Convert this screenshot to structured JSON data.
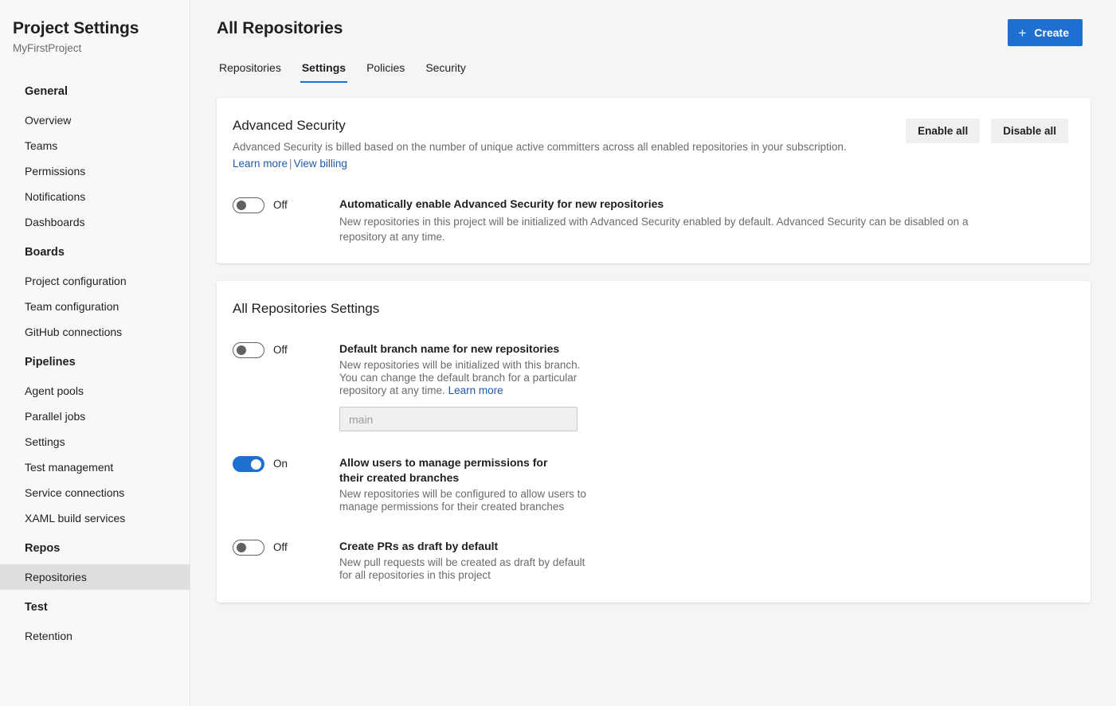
{
  "sidebar": {
    "title": "Project Settings",
    "subtitle": "MyFirstProject",
    "groups": [
      {
        "header": "General",
        "items": [
          {
            "label": "Overview",
            "selected": false
          },
          {
            "label": "Teams",
            "selected": false
          },
          {
            "label": "Permissions",
            "selected": false
          },
          {
            "label": "Notifications",
            "selected": false
          },
          {
            "label": "Dashboards",
            "selected": false
          }
        ]
      },
      {
        "header": "Boards",
        "items": [
          {
            "label": "Project configuration",
            "selected": false
          },
          {
            "label": "Team configuration",
            "selected": false
          },
          {
            "label": "GitHub connections",
            "selected": false
          }
        ]
      },
      {
        "header": "Pipelines",
        "items": [
          {
            "label": "Agent pools",
            "selected": false
          },
          {
            "label": "Parallel jobs",
            "selected": false
          },
          {
            "label": "Settings",
            "selected": false
          },
          {
            "label": "Test management",
            "selected": false
          },
          {
            "label": "Service connections",
            "selected": false
          },
          {
            "label": "XAML build services",
            "selected": false
          }
        ]
      },
      {
        "header": "Repos",
        "items": [
          {
            "label": "Repositories",
            "selected": true
          }
        ]
      },
      {
        "header": "Test",
        "items": [
          {
            "label": "Retention",
            "selected": false
          }
        ]
      }
    ]
  },
  "header": {
    "page_title": "All Repositories",
    "create_button": {
      "label": "Create",
      "icon": "plus-icon"
    },
    "tabs": [
      {
        "label": "Repositories",
        "active": false
      },
      {
        "label": "Settings",
        "active": true
      },
      {
        "label": "Policies",
        "active": false
      },
      {
        "label": "Security",
        "active": false
      }
    ]
  },
  "advanced_security": {
    "heading": "Advanced Security",
    "description": "Advanced Security is billed based on the number of unique active committers across all enabled repositories in your subscription.",
    "links": {
      "learn_more": "Learn more",
      "separator": "|",
      "view_billing": "View billing"
    },
    "actions": {
      "enable_all": "Enable all",
      "disable_all": "Disable all"
    },
    "setting": {
      "state": "Off",
      "on": false,
      "title": "Automatically enable Advanced Security for new repositories",
      "description": "New repositories in this project will be initialized with Advanced Security enabled by default. Advanced Security can be disabled on a repository at any time."
    }
  },
  "all_repositories_settings": {
    "heading": "All Repositories Settings",
    "settings": [
      {
        "state": "Off",
        "on": false,
        "title": "Default branch name for new repositories",
        "description": "New repositories will be initialized with this branch. You can change the default branch for a particular repository at any time.",
        "inline_link": "Learn more",
        "input_placeholder": "main",
        "input_value": ""
      },
      {
        "state": "On",
        "on": true,
        "title": "Allow users to manage permissions for their created branches",
        "description": "New repositories will be configured to allow users to manage permissions for their created branches"
      },
      {
        "state": "Off",
        "on": false,
        "title": "Create PRs as draft by default",
        "description": "New pull requests will be created as draft by default for all repositories in this project"
      }
    ]
  },
  "colors": {
    "accent": "#1f6fd0",
    "link": "#1f5ba8",
    "page_background": "#f5f5f5",
    "sidebar_background": "#f8f8f8",
    "card_background": "#ffffff",
    "selected_nav": "#dedede"
  }
}
